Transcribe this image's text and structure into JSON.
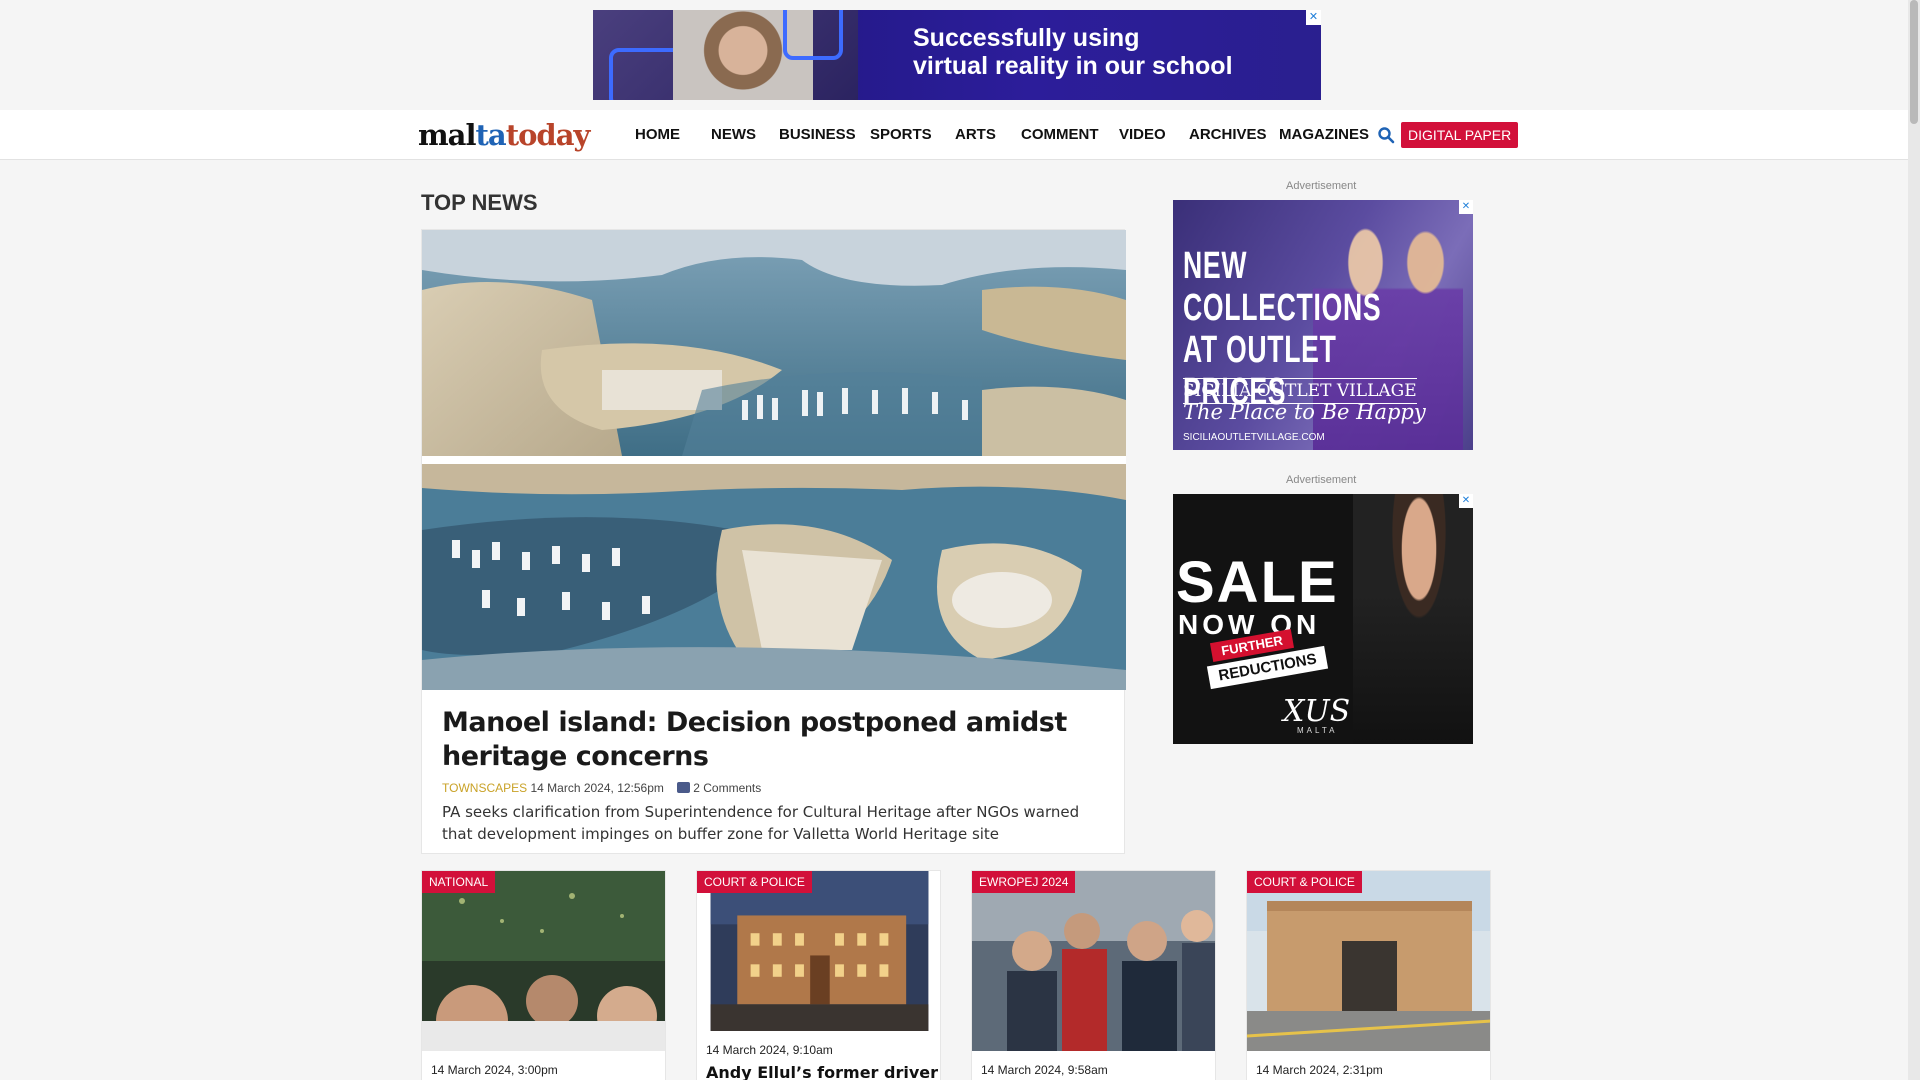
{
  "top_ad": {
    "line1": "Successfully using",
    "line2": "virtual reality in our school",
    "close": "✕"
  },
  "logo": {
    "part1": "mal",
    "part2": "ta",
    "part3": "today"
  },
  "nav": {
    "items": [
      "HOME",
      "NEWS",
      "BUSINESS",
      "SPORTS",
      "ARTS",
      "COMMENT",
      "VIDEO",
      "ARCHIVES",
      "MAGAZINES"
    ],
    "digital_paper": "DIGITAL PAPER"
  },
  "section_title": "TOP NEWS",
  "hero": {
    "title": "Manoel island: Decision postponed amidst heritage concerns",
    "category": "TOWNSCAPES",
    "date": "14 March 2024, 12:56pm",
    "comments": "2 Comments",
    "summary": "PA seeks clarification from Superintendence for Cultural Heritage after NGOs warned that development impinges on buffer zone for Valletta World Heritage site"
  },
  "side_ads": {
    "label": "Advertisement",
    "ad1": {
      "headline_1": "NEW",
      "headline_2": "COLLECTIONS",
      "headline_3": "AT OUTLET PRICES",
      "brand": "SICILIA OUTLET VILLAGE",
      "tagline": "The Place to Be Happy",
      "url": "SICILIAOUTLETVILLAGE.COM"
    },
    "ad2": {
      "sale": "SALE",
      "now_on": "NOW ON",
      "further": "FURTHER",
      "reductions": "REDUCTIONS",
      "brand": "XUS",
      "sub": "MALTA"
    }
  },
  "cards": [
    {
      "category": "NATIONAL",
      "date": "14 March 2024, 3:00pm",
      "headline": ""
    },
    {
      "category": "COURT & POLICE",
      "date": "14 March 2024, 9:10am",
      "headline": "Andy Ellul’s former driver"
    },
    {
      "category": "EWROPEJ 2024",
      "date": "14 March 2024, 9:58am",
      "headline": ""
    },
    {
      "category": "COURT & POLICE",
      "date": "14 March 2024, 2:31pm",
      "headline": ""
    }
  ],
  "colors": {
    "accent_red": "#d2103a",
    "logo_blue": "#1f63b5",
    "logo_red": "#b8442a",
    "category_gold": "#c9a227"
  }
}
